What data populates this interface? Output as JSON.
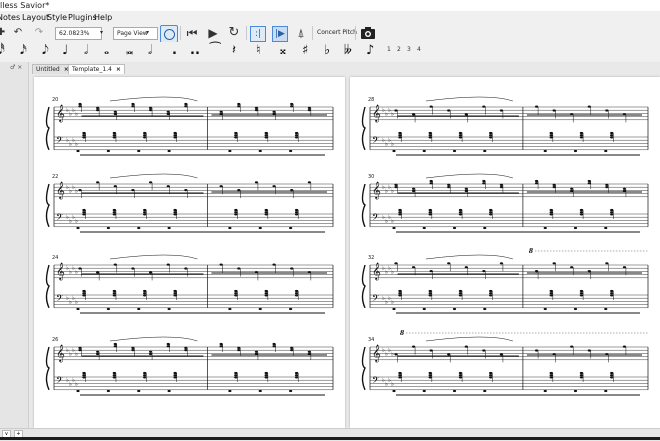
{
  "window": {
    "title": "lless Savior*"
  },
  "menu": [
    "Notes",
    "Layout",
    "Style",
    "Plugins",
    "Help"
  ],
  "toolbar": {
    "zoom_value": "62.0823%",
    "view_value": "Page View",
    "concert_pitch_label": "Concert Pitch",
    "icons": [
      "undo-icon",
      "redo-icon",
      "midi-input-icon",
      "rewind-icon",
      "play-icon",
      "loop-icon",
      "loop-in-icon",
      "loop-out-icon",
      "metronome-icon",
      "concert-pitch-toggle",
      "camera-icon"
    ]
  },
  "note_input": {
    "durations": [
      "𝅘𝅥𝅰",
      "𝅘𝅥𝅯",
      "𝅘𝅥𝅮",
      "♩",
      "𝅗𝅥",
      "𝅝",
      "𝅜",
      "𝅗𝅥",
      "."
    ],
    "double_dot": "..",
    "accidentals": [
      "♮",
      "𝄪",
      "♯",
      "♭",
      "𝄫"
    ],
    "voices": [
      "1",
      "2",
      "3",
      "4"
    ]
  },
  "left_panel": {
    "label": "♂ ×"
  },
  "tabs": [
    {
      "label": "Untitled",
      "close": "×"
    },
    {
      "label": "Template_1.4",
      "close": "×"
    }
  ],
  "score": {
    "pages": [
      {
        "systems": [
          {
            "measure": "20"
          },
          {
            "measure": "22"
          },
          {
            "measure": "24"
          },
          {
            "measure": "26"
          }
        ]
      },
      {
        "systems": [
          {
            "measure": "28"
          },
          {
            "measure": "30"
          },
          {
            "measure": "32"
          },
          {
            "measure": "34"
          }
        ]
      }
    ],
    "ottava": "8"
  },
  "status": {
    "left_btn": "∨",
    "right_btn": "+"
  }
}
